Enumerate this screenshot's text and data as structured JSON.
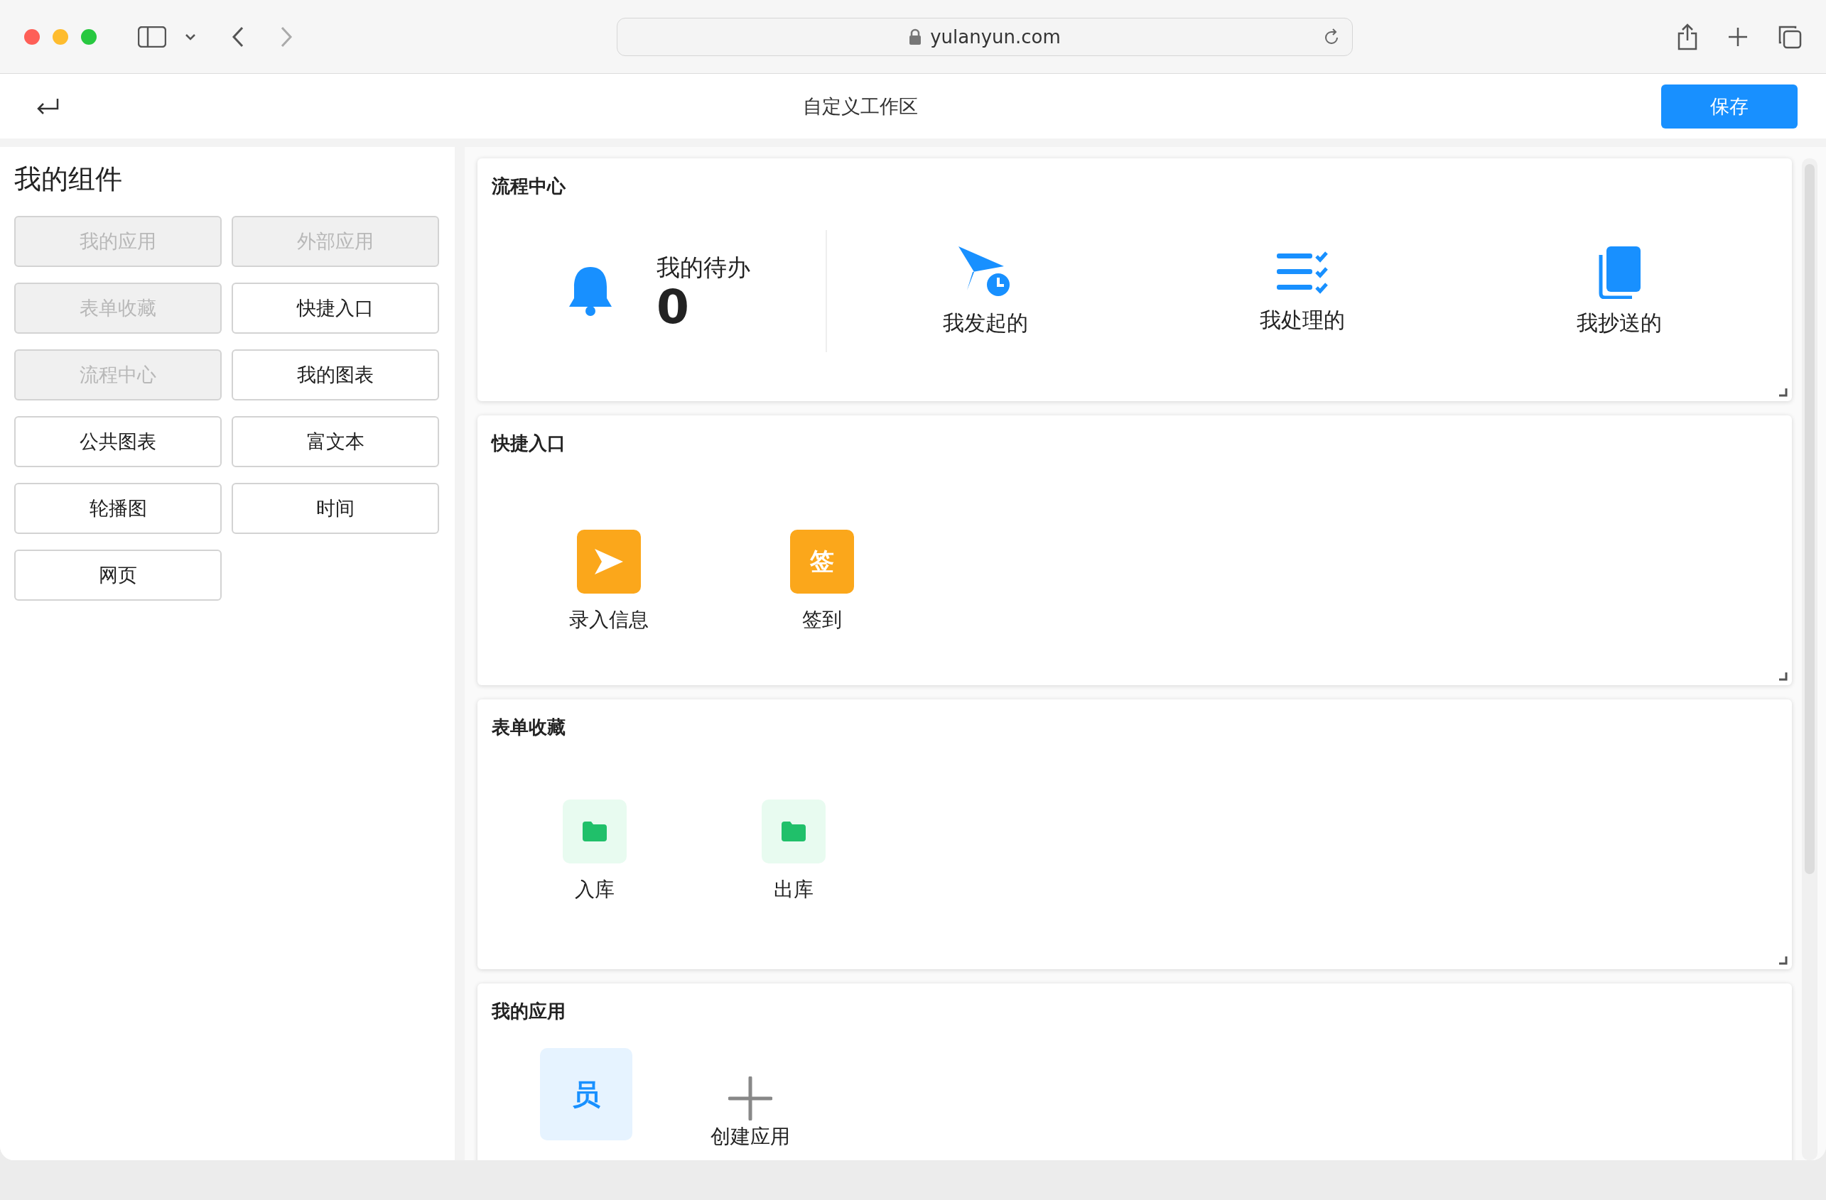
{
  "browser": {
    "url": "yulanyun.com"
  },
  "header": {
    "title": "自定义工作区",
    "save_button": "保存"
  },
  "sidebar": {
    "title": "我的组件",
    "items": [
      {
        "label": "我的应用",
        "disabled": true
      },
      {
        "label": "外部应用",
        "disabled": true
      },
      {
        "label": "表单收藏",
        "disabled": true
      },
      {
        "label": "快捷入口",
        "disabled": false
      },
      {
        "label": "流程中心",
        "disabled": true
      },
      {
        "label": "我的图表",
        "disabled": false
      },
      {
        "label": "公共图表",
        "disabled": false
      },
      {
        "label": "富文本",
        "disabled": false
      },
      {
        "label": "轮播图",
        "disabled": false
      },
      {
        "label": "时间",
        "disabled": false
      },
      {
        "label": "网页",
        "disabled": false
      }
    ]
  },
  "cards": [
    {
      "kind": "process",
      "title": "流程中心",
      "todo": {
        "label": "我的待办",
        "count": "0"
      },
      "items": [
        {
          "label": "我发起的"
        },
        {
          "label": "我处理的"
        },
        {
          "label": "我抄送的"
        }
      ]
    },
    {
      "kind": "shortcuts",
      "title": "快捷入口",
      "items": [
        {
          "kind": "icon",
          "label": "录入信息"
        },
        {
          "kind": "glyph",
          "glyph": "签",
          "label": "签到"
        }
      ]
    },
    {
      "kind": "forms",
      "title": "表单收藏",
      "items": [
        {
          "label": "入库"
        },
        {
          "label": "出库"
        }
      ]
    },
    {
      "kind": "apps",
      "title": "我的应用",
      "items": [
        {
          "kind": "app",
          "glyph": "员"
        },
        {
          "kind": "create",
          "label": "创建应用"
        }
      ]
    }
  ]
}
